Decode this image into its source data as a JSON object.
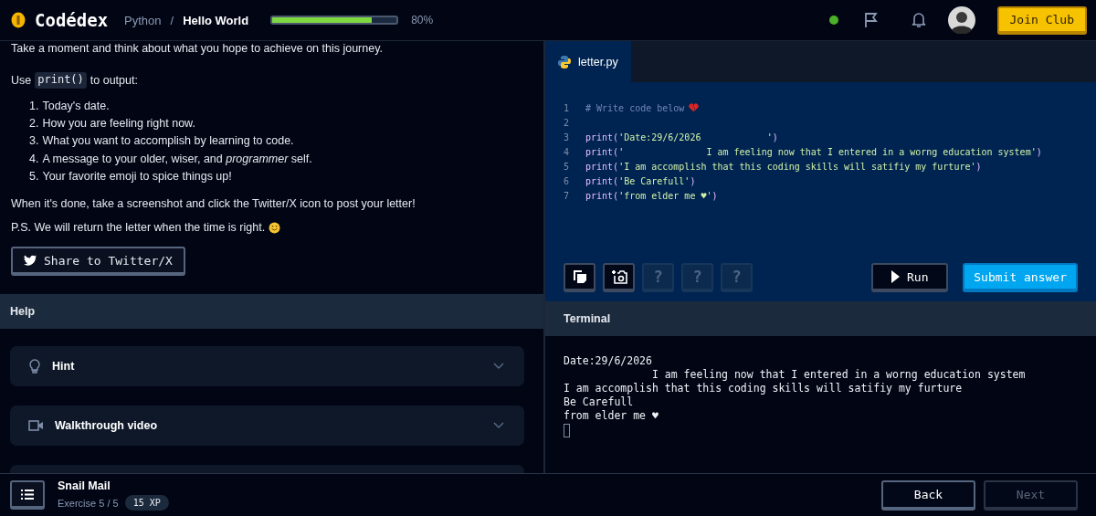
{
  "header": {
    "logo": "Codédex",
    "breadcrumb_separator": "/",
    "breadcrumb": [
      {
        "label": "Python",
        "current": false
      },
      {
        "label": "Hello World",
        "current": true
      }
    ],
    "progress": {
      "level": 0.8,
      "reading": "80%"
    },
    "online": true,
    "join_button": "Join Club"
  },
  "lesson": {
    "intro": "Take a moment and think about what you hope to achieve on this journey.",
    "use_before": "Use",
    "use_code": "print()",
    "use_after": "to output:",
    "steps": [
      {
        "number": "1.",
        "text": "Today's date."
      },
      {
        "number": "2.",
        "text": "How you are feeling right now."
      },
      {
        "number": "3.",
        "text": "What you want to accomplish by learning to code."
      },
      {
        "number": "4.",
        "text": "A message to your older, wiser, and *programmer* self."
      },
      {
        "number": "5.",
        "text": "Your favorite emoji to spice things up!"
      }
    ],
    "closing": "When it's done, take a screenshot and click the Twitter/X icon to post your letter!",
    "ps": "P.S. We will return the letter when the time is right.",
    "share_button": "Share to Twitter/X"
  },
  "help": {
    "title": "Help",
    "items": [
      {
        "kind": "hint",
        "label": "Hint",
        "expanded": false
      },
      {
        "kind": "video",
        "label": "Walkthrough video",
        "expanded": false
      }
    ]
  },
  "editor": {
    "tabs": [
      {
        "label": "letter.py",
        "selected": true
      }
    ],
    "lines": [
      {
        "number": "1",
        "tokens": [
          {
            "kind": "comment",
            "text": "# Write code below"
          }
        ],
        "emoji": true
      },
      {
        "number": "2"
      },
      {
        "number": "3",
        "tokens": [
          {
            "kind": "func",
            "text": "print("
          },
          {
            "kind": "string",
            "text": "'Date:29/6/2026            '"
          },
          {
            "kind": "func",
            "text": ")"
          }
        ]
      },
      {
        "number": "4",
        "tokens": [
          {
            "kind": "func",
            "text": "print("
          },
          {
            "kind": "string",
            "text": "'               I am feeling now that I entered in a worng education system'"
          },
          {
            "kind": "func",
            "text": ")"
          }
        ]
      },
      {
        "number": "5",
        "tokens": [
          {
            "kind": "func",
            "text": "print("
          },
          {
            "kind": "string",
            "text": "'I am accomplish that this coding skills will satifiy my furture'"
          },
          {
            "kind": "func",
            "text": ")"
          }
        ]
      },
      {
        "number": "6",
        "tokens": [
          {
            "kind": "func",
            "text": "print("
          },
          {
            "kind": "string",
            "text": "'Be Carefull'"
          },
          {
            "kind": "func",
            "text": ")"
          }
        ]
      },
      {
        "number": "7",
        "tokens": [
          {
            "kind": "func",
            "text": "print("
          },
          {
            "kind": "string",
            "text": "'from elder me ♥'"
          },
          {
            "kind": "func",
            "text": ")"
          }
        ]
      }
    ],
    "tools": [
      {
        "kind": "copy",
        "disabled": false
      },
      {
        "kind": "screenshot",
        "disabled": false
      },
      {
        "kind": "locked",
        "label": "?",
        "disabled": true
      },
      {
        "kind": "locked",
        "label": "?",
        "disabled": true
      },
      {
        "kind": "locked",
        "label": "?",
        "disabled": true
      }
    ],
    "run_button": "Run",
    "submit_button": "Submit answer"
  },
  "terminal": {
    "title": "Terminal",
    "output": [
      "Date:29/6/2026",
      "              I am feeling now that I entered in a worng education system",
      "I am accomplish that this coding skills will satifiy my furture",
      "Be Carefull",
      "from elder me ♥"
    ]
  },
  "footer": {
    "title": "Snail Mail",
    "exercise": "Exercise 5 / 5",
    "xp": "15 XP",
    "back_button": "Back",
    "next_button": {
      "label": "Next",
      "disabled": true
    }
  }
}
